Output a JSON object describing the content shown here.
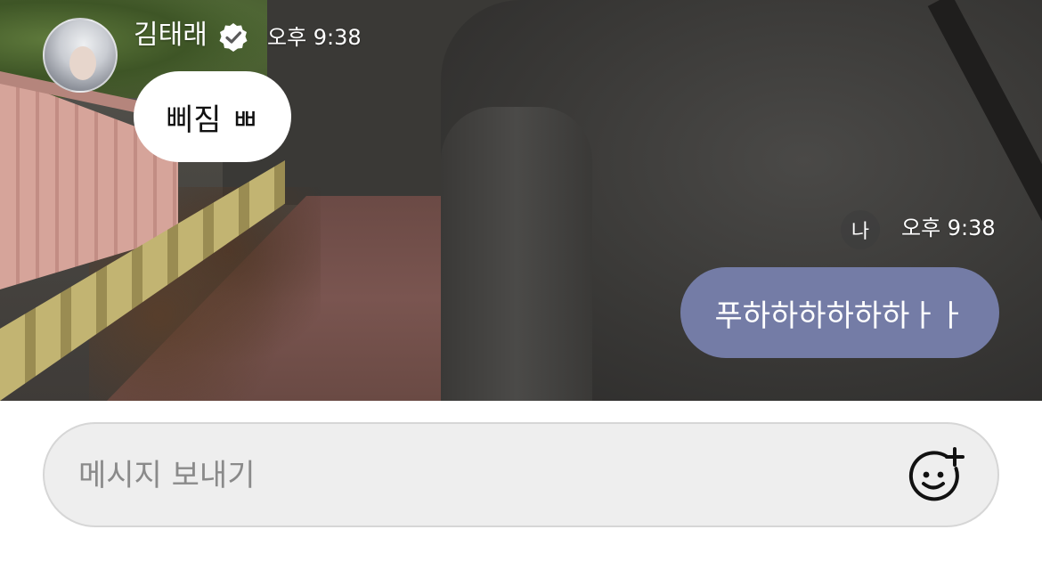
{
  "chat": {
    "incoming": {
      "sender_name": "김태래",
      "verified_icon": "verified-badge-icon",
      "time": "오후 9:38",
      "message": "삐짐 ㅃ"
    },
    "outgoing": {
      "me_label": "나",
      "time": "오후 9:38",
      "message": "푸하하하하하하ㅏㅏ"
    }
  },
  "composer": {
    "placeholder": "메시지 보내기",
    "emoji_icon": "add-emoji-icon"
  },
  "colors": {
    "outgoing_bubble": "#747ca6",
    "incoming_bubble": "#ffffff",
    "composer_bg": "#eeeeee"
  }
}
